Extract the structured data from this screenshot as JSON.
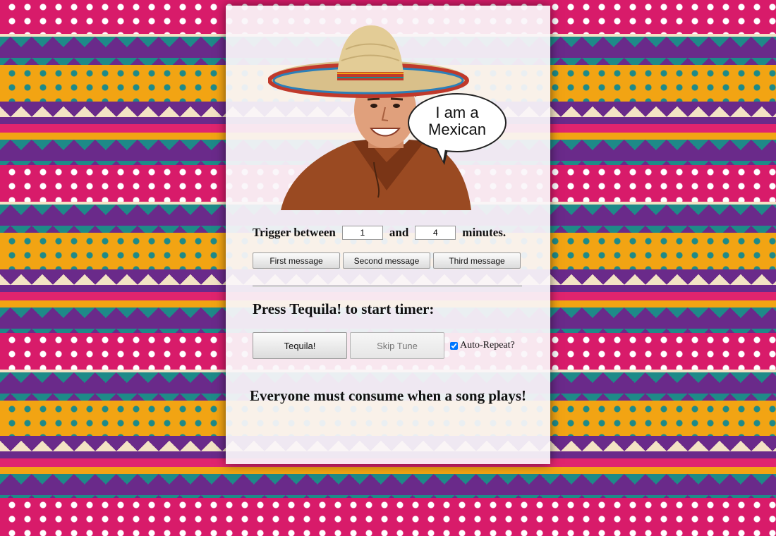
{
  "hero": {
    "speech_bubble": "I am a Mexican"
  },
  "trigger": {
    "label_before": "Trigger between",
    "min_value": "1",
    "label_middle": "and",
    "max_value": "4",
    "label_after": "minutes."
  },
  "message_buttons": [
    {
      "label": "First message"
    },
    {
      "label": "Second message"
    },
    {
      "label": "Third message"
    }
  ],
  "timer": {
    "title": "Press Tequila! to start timer:",
    "tequila_label": "Tequila!",
    "skip_label": "Skip Tune",
    "auto_repeat_label": "Auto-Repeat?",
    "auto_repeat_checked": true
  },
  "footer": {
    "message": "Everyone must consume when a song plays!"
  },
  "colors": {
    "pink": "#d81b6a",
    "orange": "#f2a413",
    "teal": "#1e8a88",
    "purple": "#5f2483",
    "cream": "#f3e3c4"
  }
}
